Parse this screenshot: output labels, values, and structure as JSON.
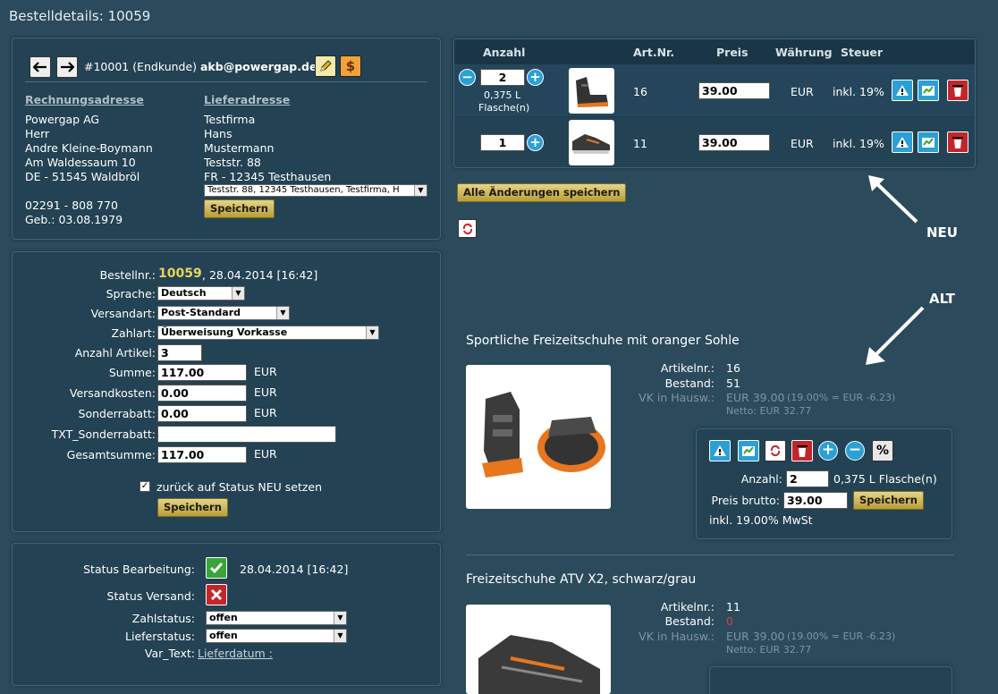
{
  "page_title": "Bestelldetails: 10059",
  "customer": {
    "label": "#10001 (Endkunde)",
    "email": "akb@powergap.de",
    "billing_heading": "Rechnungsadresse",
    "shipping_heading": "Lieferadresse",
    "billing_lines": [
      "Powergap AG",
      "Herr",
      "Andre Kleine-Boymann",
      "Am Waldessaum 10",
      "DE - 51545 Waldbröl"
    ],
    "shipping_lines": [
      "Testfirma",
      "Hans",
      "Mustermann",
      "Teststr. 88",
      "FR - 12345 Testhausen"
    ],
    "address_select": "Teststr. 88, 12345 Testhausen, Testfirma, H",
    "phone": "02291 - 808 770",
    "birthday": "Geb.: 03.08.1979",
    "save_label": "Speichern"
  },
  "order": {
    "number_label": "Bestellnr.:",
    "number": "10059",
    "date": ", 28.04.2014 [16:42]",
    "language_label": "Sprache:",
    "language": "Deutsch",
    "shipping_label": "Versandart:",
    "shipping": "Post-Standard",
    "payment_label": "Zahlart:",
    "payment": "Überweisung Vorkasse",
    "count_label": "Anzahl Artikel:",
    "count": "3",
    "sum_label": "Summe:",
    "sum": "117.00",
    "shipcost_label": "Versandkosten:",
    "shipcost": "0.00",
    "discount_label": "Sonderrabatt:",
    "discount": "0.00",
    "txt_discount_label": "TXT_Sonderrabatt:",
    "txt_discount": "",
    "total_label": "Gesamtsumme:",
    "total": "117.00",
    "currency": "EUR",
    "reset_label": "zurück auf Status NEU setzen",
    "reset_checked": true,
    "save_label": "Speichern"
  },
  "status": {
    "processing_label": "Status Bearbeitung:",
    "processing_date": "28.04.2014 [16:42]",
    "shipping_label": "Status Versand:",
    "pay_status_label": "Zahlstatus:",
    "pay_status": "offen",
    "delivery_status_label": "Lieferstatus:",
    "delivery_status": "offen",
    "var_text_label": "Var_Text:",
    "var_text_link": "Lieferdatum :"
  },
  "cart": {
    "headers": {
      "qty": "Anzahl",
      "artnr": "Art.Nr.",
      "price": "Preis",
      "currency": "Währung",
      "tax": "Steuer"
    },
    "rows": [
      {
        "qty": "2",
        "unit": "0,375 L",
        "unit2": "Flasche(n)",
        "artnr": "16",
        "price": "39.00",
        "currency": "EUR",
        "tax": "inkl. 19%"
      },
      {
        "qty": "1",
        "unit": "",
        "unit2": "",
        "artnr": "11",
        "price": "39.00",
        "currency": "EUR",
        "tax": "inkl. 19%"
      }
    ],
    "save_all_label": "Alle Änderungen speichern"
  },
  "annotations": {
    "new": "NEU",
    "old": "ALT"
  },
  "products": [
    {
      "title": "Sportliche Freizeitschuhe mit oranger Sohle",
      "artnr_label": "Artikelnr.:",
      "artnr": "16",
      "stock_label": "Bestand:",
      "stock": "51",
      "vk_label": "VK in Hausw.:",
      "vk": "EUR 39.00",
      "vk_note": "(19.00% = EUR -6.23)",
      "netto": "Netto: EUR 32.77",
      "qty_label": "Anzahl:",
      "qty": "2",
      "unit": "0,375 L Flasche(n)",
      "price_label": "Preis brutto:",
      "price": "39.00",
      "save_label": "Speichern",
      "tax_note": "inkl. 19.00% MwSt"
    },
    {
      "title": "Freizeitschuhe ATV X2, schwarz/grau",
      "artnr_label": "Artikelnr.:",
      "artnr": "11",
      "stock_label": "Bestand:",
      "stock": "0",
      "vk_label": "VK in Hausw.:",
      "vk": "EUR 39.00",
      "vk_note": "(19.00% = EUR -6.23)",
      "netto": "Netto: EUR 32.77"
    }
  ],
  "colors": {
    "background": "#2b4a5c",
    "panel": "#234253",
    "button_gold": "#d9c472",
    "order_number": "#e8d35c",
    "icon_blue": "#2aa0d6",
    "icon_red": "#c2262b",
    "icon_green": "#3aa43a"
  }
}
